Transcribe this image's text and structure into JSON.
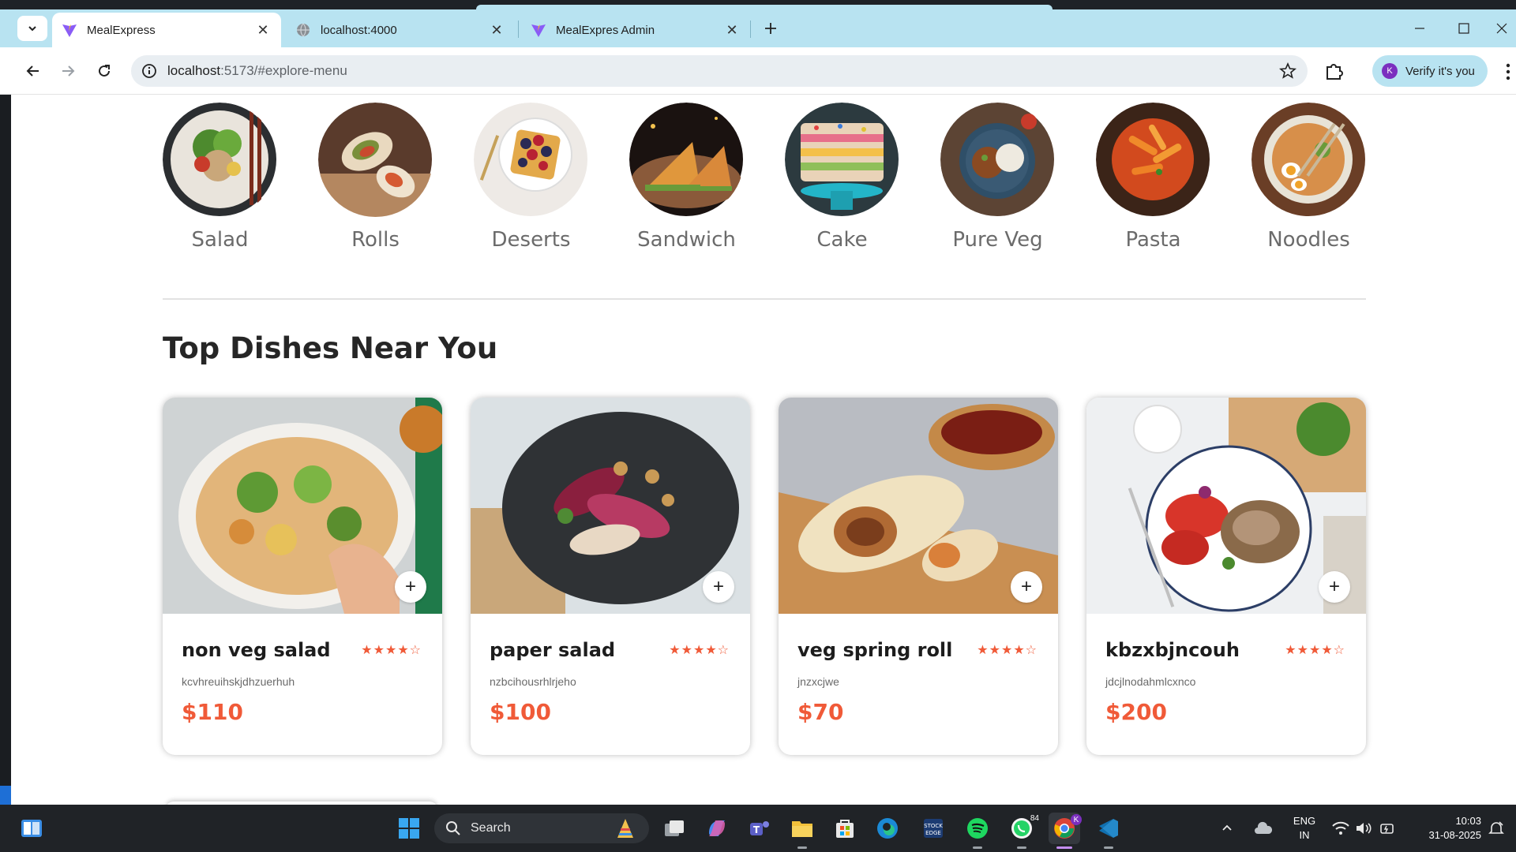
{
  "browser": {
    "tabs": [
      {
        "title": "MealExpress",
        "active": true
      },
      {
        "title": "localhost:4000",
        "active": false
      },
      {
        "title": "MealExpres Admin",
        "active": false
      }
    ],
    "url_host": "localhost",
    "url_rest": ":5173/#explore-menu",
    "profile_initial": "K",
    "profile_label": "Verify it's you"
  },
  "menu": {
    "items": [
      {
        "label": "Salad"
      },
      {
        "label": "Rolls"
      },
      {
        "label": "Deserts"
      },
      {
        "label": "Sandwich"
      },
      {
        "label": "Cake"
      },
      {
        "label": "Pure Veg"
      },
      {
        "label": "Pasta"
      },
      {
        "label": "Noodles"
      }
    ]
  },
  "section_title": "Top Dishes Near You",
  "dishes": [
    {
      "name": "non veg salad",
      "description": "kcvhreuihskjdhzuerhuh",
      "price": "$110",
      "rating": 4
    },
    {
      "name": "paper salad",
      "description": "nzbcihousrhlrjeho",
      "price": "$100",
      "rating": 4
    },
    {
      "name": "veg spring roll",
      "description": "jnzxcjwe",
      "price": "$70",
      "rating": 4
    },
    {
      "name": "kbzxbjncouh",
      "description": "jdcjlnodahmlcxnco",
      "price": "$200",
      "rating": 4
    }
  ],
  "colors": {
    "accent": "#f05a38",
    "tabbar": "#b8e3f1"
  },
  "taskbar": {
    "search_label": "Search",
    "lang_line1": "ENG",
    "lang_line2": "IN",
    "time": "10:03",
    "date": "31-08-2025",
    "whatsapp_badge": "84",
    "chrome_badge": "K"
  }
}
